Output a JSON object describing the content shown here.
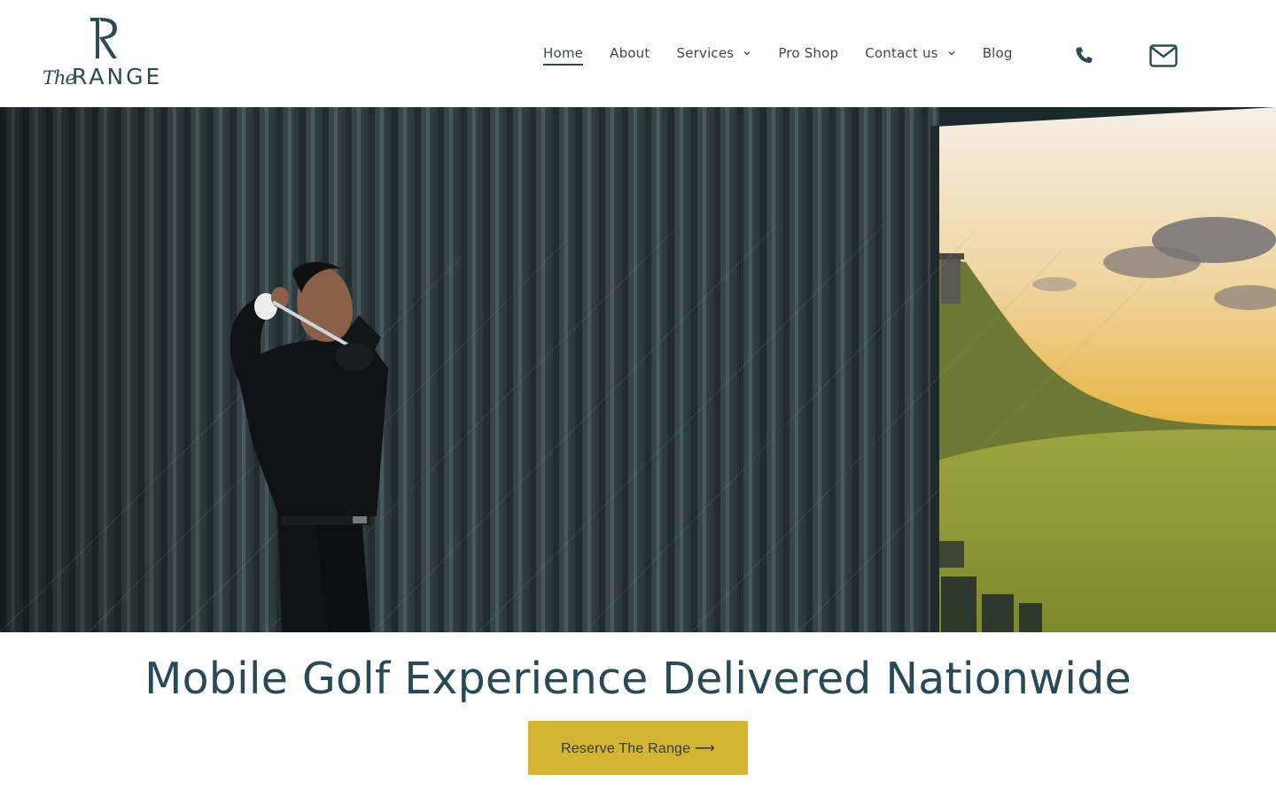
{
  "brand": {
    "script": "The",
    "name": "RANGE",
    "color": "#2b4a55"
  },
  "nav": {
    "items": [
      {
        "label": "Home",
        "active": true,
        "dropdown": false
      },
      {
        "label": "About",
        "active": false,
        "dropdown": false
      },
      {
        "label": "Services",
        "active": false,
        "dropdown": true
      },
      {
        "label": "Pro Shop",
        "active": false,
        "dropdown": false
      },
      {
        "label": "Contact us",
        "active": false,
        "dropdown": true
      },
      {
        "label": "Blog",
        "active": false,
        "dropdown": false
      }
    ]
  },
  "header_icons": {
    "phone": "phone-icon",
    "mail": "mail-icon"
  },
  "hero": {
    "image": "golfer-swinging-in-simulator-bay"
  },
  "headline": "Mobile Golf Experience Delivered Nationwide",
  "cta": {
    "label": "Reserve The Range ⟶",
    "color": "#d3b533"
  }
}
